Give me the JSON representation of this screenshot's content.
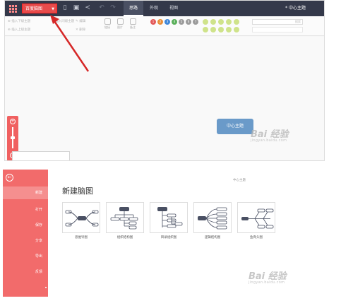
{
  "top": {
    "menu_button": {
      "label": "百度脑图"
    },
    "tabs": [
      {
        "label": "思路",
        "active": true
      },
      {
        "label": "外观",
        "active": false
      },
      {
        "label": "视图",
        "active": false
      }
    ],
    "document_title": "* 中心主题",
    "ribbon": {
      "insert_child": "插入下级主题",
      "insert_parent": "插入上级主题",
      "insert_sibling": "插入同级主题",
      "delete": "删除",
      "edit": "编辑",
      "link": "链接",
      "image": "图片",
      "note": "备注",
      "priority_labels": [
        "1",
        "2",
        "3",
        "4",
        "5",
        "6",
        "7"
      ],
      "priority_colors": [
        "#e35a5a",
        "#e98f3a",
        "#3f87d9",
        "#5ab05a",
        "#9b9b9b",
        "#9b9b9b",
        "#9b9b9b"
      ],
      "search_hint": "搜索"
    },
    "central_topic": "中心主题",
    "zoom": {
      "plus": "+",
      "minus": "−",
      "level": 0.5
    }
  },
  "bottom": {
    "back_icon": "back-arrow-icon",
    "document_title": "中心主题",
    "heading": "新建脑图",
    "sidebar": [
      {
        "label": "新建",
        "active": true
      },
      {
        "label": "打开",
        "active": false
      },
      {
        "label": "保存",
        "active": false
      },
      {
        "label": "分享",
        "active": false
      },
      {
        "label": "导出",
        "active": false
      },
      {
        "label": "反馈",
        "active": false
      }
    ],
    "templates": [
      {
        "label": "思维导图",
        "icon": "mindmap-icon"
      },
      {
        "label": "组织结构图",
        "icon": "org-chart-icon"
      },
      {
        "label": "目录组织图",
        "icon": "directory-chart-icon"
      },
      {
        "label": "逻辑结构图",
        "icon": "logic-chart-icon"
      },
      {
        "label": "鱼骨头图",
        "icon": "fishbone-icon"
      }
    ]
  },
  "watermark": {
    "brand": "Bai 经验",
    "url": "jingyan.baidu.com"
  },
  "colors": {
    "accent": "#e74c4c",
    "titlebar": "#34394a",
    "sidebar": "#f26b6b",
    "node": "#6a9ac9"
  }
}
